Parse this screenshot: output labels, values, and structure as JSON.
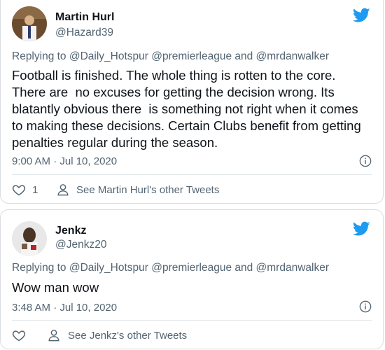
{
  "tweets": [
    {
      "name": "Martin Hurl",
      "handle": "@Hazard39",
      "reply_prefix": "Replying to",
      "reply_to": "@Daily_Hotspur @premierleague and @mrdanwalker",
      "text_lines": [
        "Football is finished. The whole thing is rotten to the core.",
        "There are  no excuses for getting the decision wrong. Its",
        "blatantly obvious there  is something not right when it comes",
        "to making these decisions. Certain Clubs benefit from getting",
        "penalties regular during the season."
      ],
      "timestamp": "9:00 AM · Jul 10, 2020",
      "like_count": "1",
      "see_more": "See Martin Hurl's other Tweets"
    },
    {
      "name": "Jenkz",
      "handle": "@Jenkz20",
      "reply_prefix": "Replying to",
      "reply_to": "@Daily_Hotspur @premierleague and @mrdanwalker",
      "text_lines": [
        "Wow man wow"
      ],
      "timestamp": "3:48 AM · Jul 10, 2020",
      "like_count": "",
      "see_more": "See Jenkz's other Tweets"
    }
  ],
  "icons": {
    "bird": "twitter-bird-icon",
    "info": "info-icon",
    "heart": "heart-icon",
    "person": "person-icon"
  },
  "colors": {
    "twitter_blue": "#1d9bf0",
    "secondary_text": "#536471",
    "primary_text": "#0f1419"
  }
}
